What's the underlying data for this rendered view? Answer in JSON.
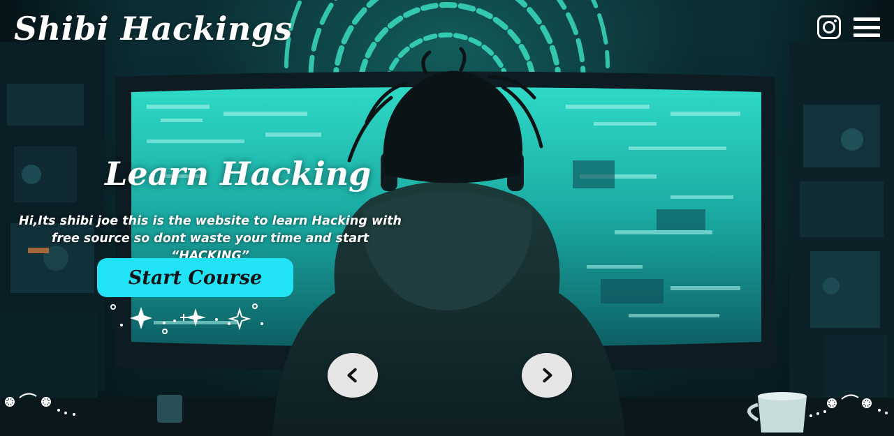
{
  "brand": {
    "logo_text": "Shibi Hackings"
  },
  "nav": {
    "instagram_icon": "instagram-icon",
    "menu_icon": "hamburger-menu-icon"
  },
  "hero": {
    "headline": "Learn Hacking",
    "subtext": "Hi,Its shibi joe this is the website to learn Hacking with free source so dont waste your time and start “HACKING”",
    "cta_label": "Start Course"
  },
  "carousel": {
    "prev_icon": "chevron-left-icon",
    "next_icon": "chevron-right-icon"
  },
  "colors": {
    "accent": "#22e3f5",
    "text": "#ffffff",
    "arrow_bg": "#e6e6e6"
  }
}
